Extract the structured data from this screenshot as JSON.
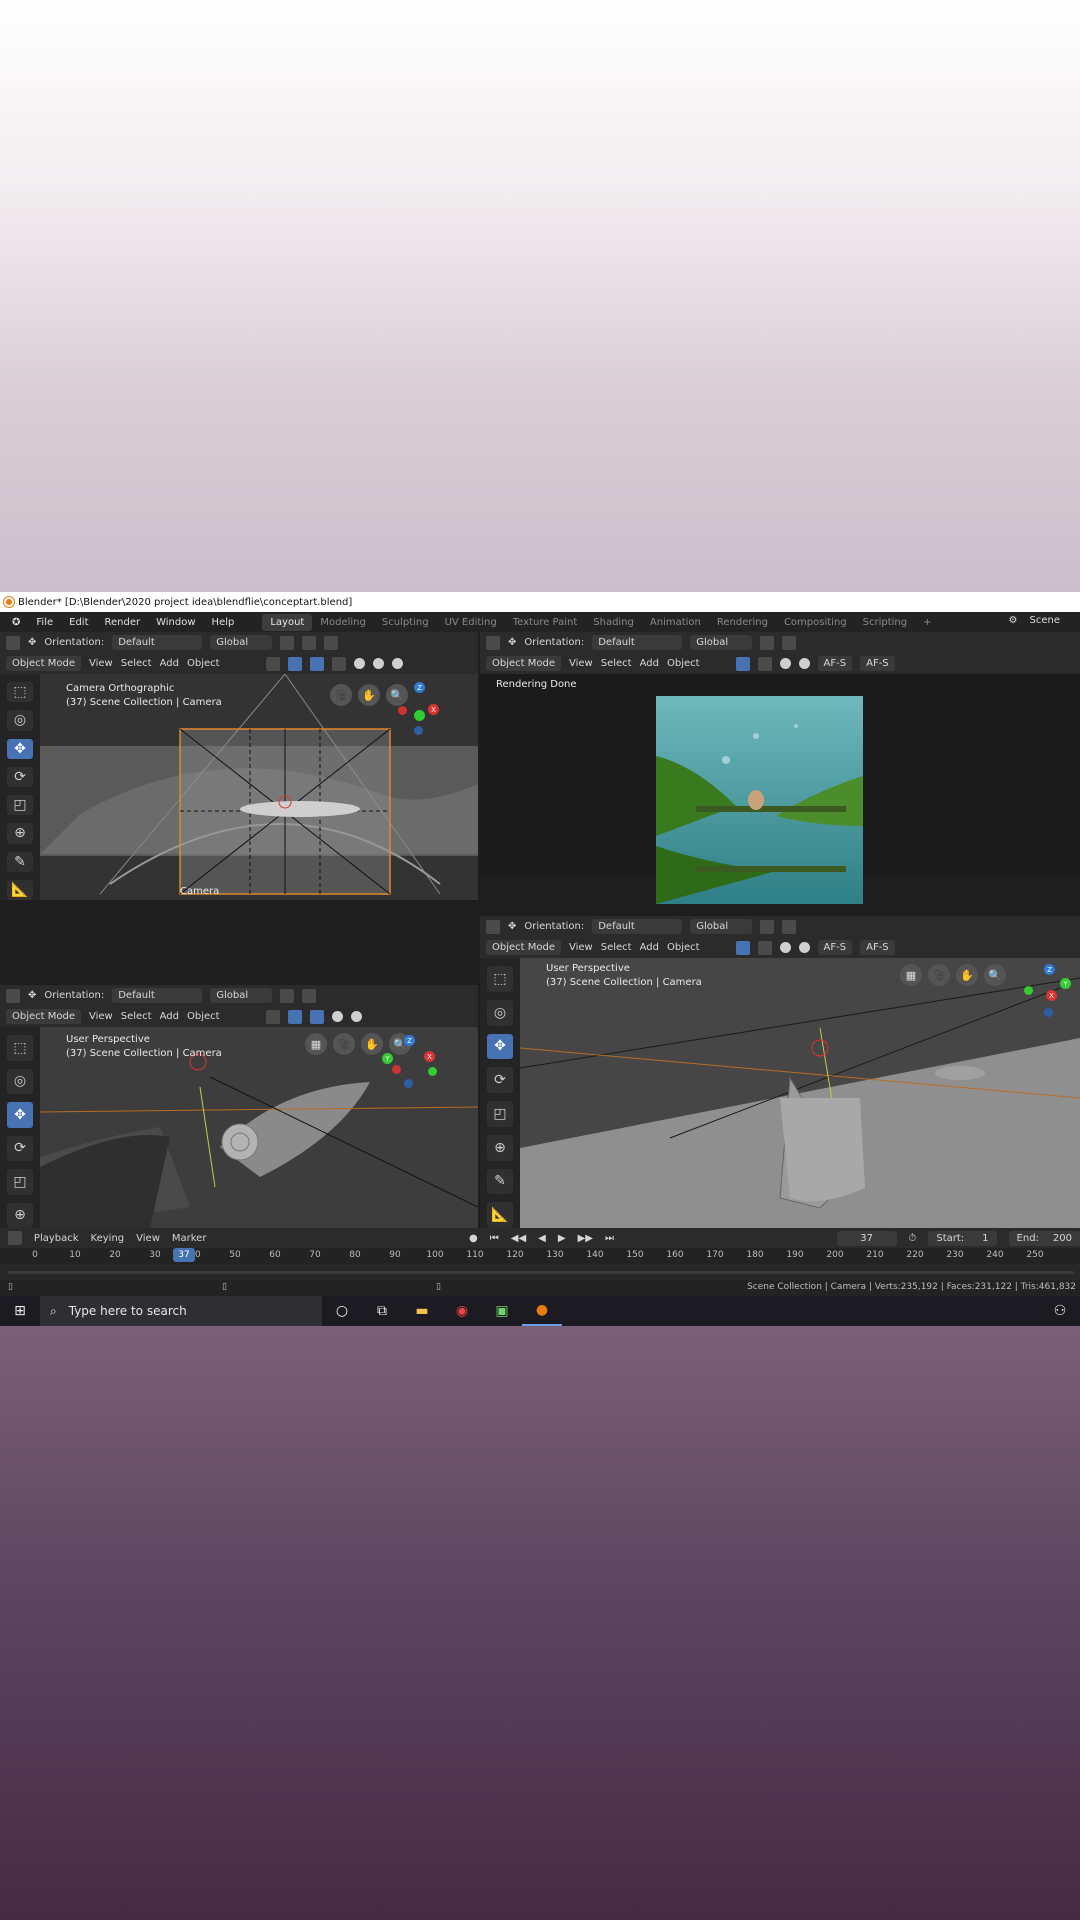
{
  "window": {
    "title": "Blender* [D:\\Blender\\2020 project idea\\blendflie\\conceptart.blend]"
  },
  "menu": {
    "items": [
      "File",
      "Edit",
      "Render",
      "Window",
      "Help"
    ]
  },
  "workspaces": [
    "Layout",
    "Modeling",
    "Sculpting",
    "UV Editing",
    "Texture Paint",
    "Shading",
    "Animation",
    "Rendering",
    "Compositing",
    "Scripting",
    "+"
  ],
  "scene": {
    "label": "Scene"
  },
  "header": {
    "orientation_label": "Orientation:",
    "orientation_value": "Default",
    "transform_value": "Global",
    "mode": "Object Mode",
    "menus": [
      "View",
      "Select",
      "Add",
      "Object"
    ],
    "afs": "AF-S"
  },
  "viewports": {
    "top_left": {
      "line1": "Camera Orthographic",
      "line2": "(37) Scene Collection | Camera",
      "camera_label": "Camera"
    },
    "top_right": {
      "line1": "Rendering Done"
    },
    "bottom_left": {
      "line1": "User Perspective",
      "line2": "(37) Scene Collection | Camera"
    },
    "bottom_right": {
      "line1": "User Perspective",
      "line2": "(37) Scene Collection | Camera"
    }
  },
  "timeline": {
    "menus": [
      "Playback",
      "Keying",
      "View",
      "Marker"
    ],
    "current_frame": "37",
    "start_label": "Start:",
    "start_value": "1",
    "end_label": "End:",
    "end_value": "200",
    "ticks": [
      "0",
      "10",
      "20",
      "30",
      "40",
      "50",
      "60",
      "70",
      "80",
      "90",
      "100",
      "110",
      "120",
      "130",
      "140",
      "150",
      "160",
      "170",
      "180",
      "190",
      "200",
      "210",
      "220",
      "230",
      "240",
      "250"
    ],
    "badge": "37"
  },
  "status": {
    "text": "Scene Collection | Camera | Verts:235,192 | Faces:231,122 | Tris:461,832"
  },
  "taskbar": {
    "search_placeholder": "Type here to search"
  },
  "colors": {
    "accent": "#4772b3",
    "bg": "#1e1e1e",
    "header": "#2b2b2b",
    "viewport": "#3e3e3e"
  }
}
